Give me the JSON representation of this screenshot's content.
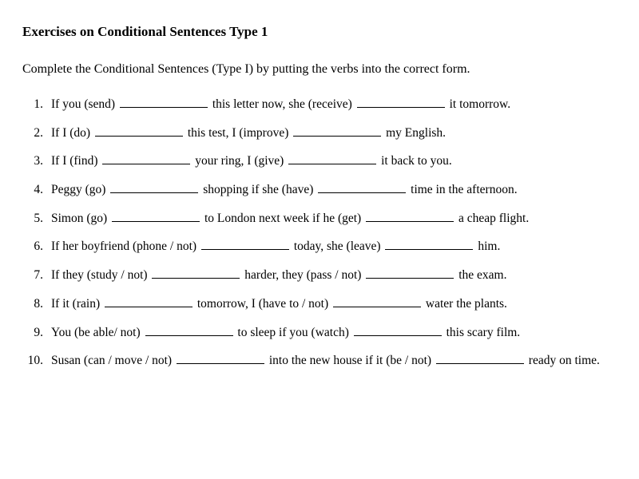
{
  "title": "Exercises on Conditional Sentences Type 1",
  "instructions": "Complete the Conditional Sentences (Type I) by putting the verbs into the correct form.",
  "exercises": [
    {
      "num": "1.",
      "parts": [
        "If you (send) ",
        "BLANK",
        " this letter now, she (receive) ",
        "BLANK",
        " it tomorrow."
      ]
    },
    {
      "num": "2.",
      "parts": [
        "If I (do) ",
        "BLANK",
        "  this test, I (improve) ",
        "BLANK",
        "  my English."
      ]
    },
    {
      "num": "3.",
      "parts": [
        "If I (find) ",
        "BLANK",
        "  your ring, I (give) ",
        "BLANK",
        "  it back to you."
      ]
    },
    {
      "num": "4.",
      "parts": [
        "Peggy (go) ",
        "BLANK",
        "  shopping if she (have) ",
        "BLANK",
        "  time in the afternoon."
      ]
    },
    {
      "num": "5.",
      "parts": [
        "Simon (go) ",
        "BLANK",
        "  to London next week if he (get) ",
        "BLANK",
        "  a cheap flight."
      ]
    },
    {
      "num": "6.",
      "parts": [
        "If her boyfriend (phone / not) ",
        "BLANK",
        "  today, she (leave) ",
        "BLANK",
        "  him."
      ]
    },
    {
      "num": "7.",
      "parts": [
        "If they (study / not) ",
        "BLANK",
        "  harder, they (pass / not) ",
        "BLANK",
        "  the exam."
      ]
    },
    {
      "num": "8.",
      "parts": [
        "If it (rain) ",
        "BLANK",
        "  tomorrow, I (have to / not) ",
        "BLANK",
        "  water the plants."
      ]
    },
    {
      "num": "9.",
      "parts": [
        "You (be able/ not) ",
        "BLANK",
        "  to sleep if you (watch) ",
        "BLANK",
        "  this scary film."
      ]
    },
    {
      "num": "10.",
      "parts": [
        "Susan (can / move / not) ",
        "BLANK",
        "  into the new house if it (be / not) ",
        "BLANK",
        "  ready on time."
      ]
    }
  ]
}
